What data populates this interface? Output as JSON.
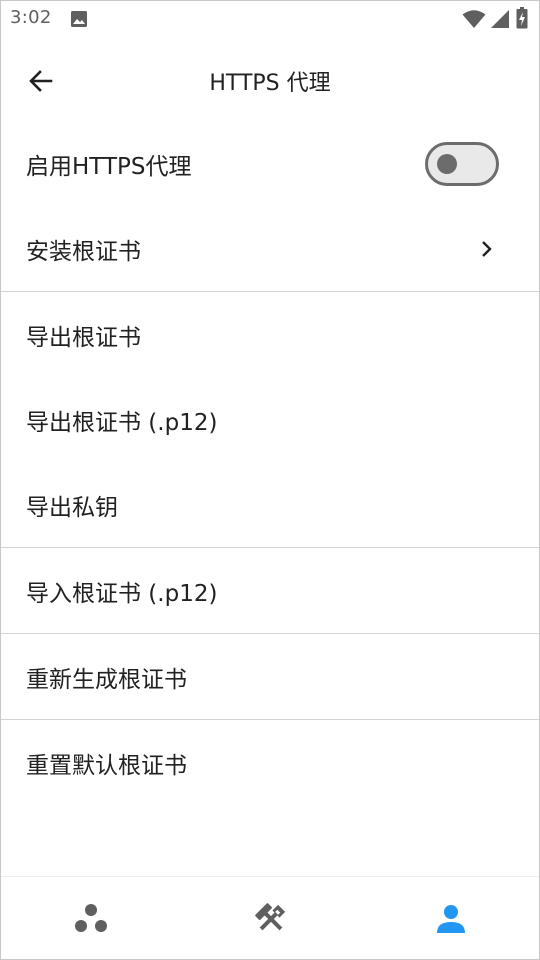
{
  "status_bar": {
    "time": "3:02",
    "icons": [
      "photo-icon",
      "wifi-icon",
      "signal-icon",
      "battery-icon"
    ]
  },
  "toolbar": {
    "title": "HTTPS 代理",
    "back_icon": "arrow-left-icon"
  },
  "settings": {
    "enable_https_proxy": {
      "label": "启用HTTPS代理",
      "enabled": false
    },
    "install_root_cert": "安装根证书",
    "export_root_cert": "导出根证书",
    "export_root_cert_p12": "导出根证书 (.p12)",
    "export_private_key": "导出私钥",
    "import_root_cert_p12": "导入根证书 (.p12)",
    "regenerate_root_cert": "重新生成根证书",
    "reset_default_root_cert": "重置默认根证书"
  },
  "bottom_nav": {
    "items": [
      {
        "icon": "dots-cluster-icon",
        "active": false
      },
      {
        "icon": "tools-icon",
        "active": false
      },
      {
        "icon": "person-icon",
        "active": true
      }
    ]
  },
  "colors": {
    "text": "#212121",
    "icon_gray": "#5f5f5f",
    "divider": "#d4d4d4",
    "toggle_track_border": "#6c6c6c",
    "toggle_track_fill": "#e9e9e9",
    "active_accent": "#2196f3"
  }
}
